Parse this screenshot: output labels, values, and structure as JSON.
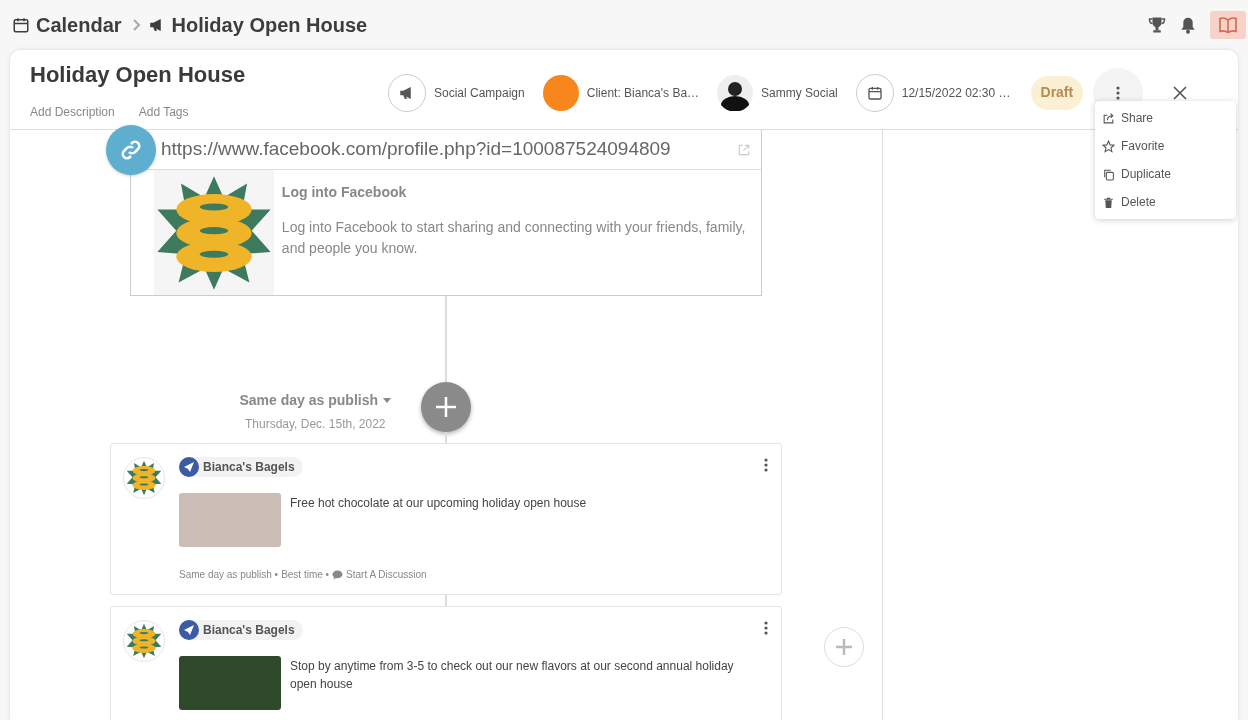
{
  "breadcrumb": [
    {
      "kind": "calendar",
      "label": "Calendar"
    },
    {
      "kind": "campaign",
      "label": "Holiday Open House"
    }
  ],
  "title": "Holiday Open House",
  "header_links": [
    "Add Description",
    "Add Tags"
  ],
  "meta": [
    {
      "kind": "campaign",
      "label": "Social Campaign"
    },
    {
      "kind": "client",
      "label": "Client: Bianca's Ba…"
    },
    {
      "kind": "owner",
      "label": "Sammy Social"
    },
    {
      "kind": "date",
      "label": "12/15/2022 02:30 …"
    }
  ],
  "status": "Draft",
  "menu": [
    {
      "kind": "share",
      "label": "Share"
    },
    {
      "kind": "favorite",
      "label": "Favorite"
    },
    {
      "kind": "duplicate",
      "label": "Duplicate"
    },
    {
      "kind": "delete",
      "label": "Delete"
    }
  ],
  "link_preview": {
    "url": "https://www.facebook.com/profile.php?id=100087524094809",
    "title": "Log into Facebook",
    "description": "Log into Facebook to start sharing and connecting with your friends, family, and people you know."
  },
  "schedule": {
    "label": "Same day as publish",
    "date": "Thursday, Dec. 15th, 2022"
  },
  "posts": [
    {
      "account": "Bianca's Bagels",
      "text": "Free hot chocolate at our upcoming holiday open house",
      "footer": {
        "timing": "Same day as publish •",
        "time": "Best time •",
        "discussion": "Start A Discussion"
      }
    },
    {
      "account": "Bianca's Bagels",
      "text": "Stop by anytime from 3-5 to check out our new flavors at our second annual holiday open house"
    }
  ]
}
